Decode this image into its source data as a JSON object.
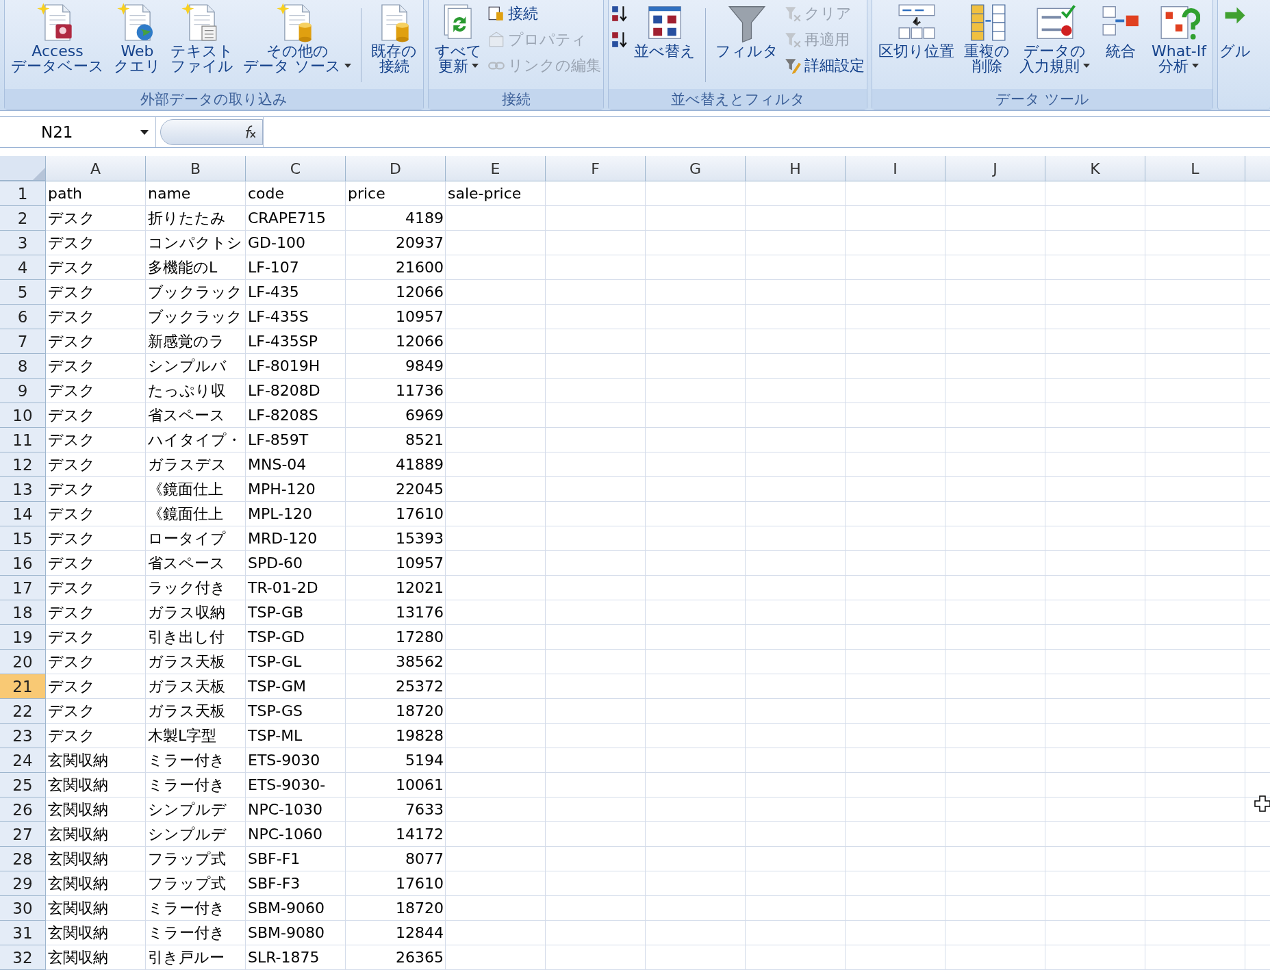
{
  "ribbon": {
    "groups": [
      {
        "label": "外部データの取り込み",
        "items": [
          {
            "kind": "large",
            "lines": [
              "Access",
              "データベース"
            ],
            "dropdown": false
          },
          {
            "kind": "large",
            "lines": [
              "Web",
              "クエリ"
            ],
            "dropdown": false
          },
          {
            "kind": "large",
            "lines": [
              "テキスト",
              "ファイル"
            ],
            "dropdown": false
          },
          {
            "kind": "large",
            "lines": [
              "その他の",
              "データ ソース"
            ],
            "dropdown": true
          },
          {
            "kind": "separator"
          },
          {
            "kind": "large",
            "lines": [
              "既存の",
              "接続"
            ],
            "dropdown": false
          }
        ]
      },
      {
        "label": "接続",
        "items": [
          {
            "kind": "large",
            "lines": [
              "すべて",
              "更新"
            ],
            "dropdown": true
          },
          {
            "kind": "stack",
            "items": [
              {
                "label": "接続",
                "disabled": false
              },
              {
                "label": "プロパティ",
                "disabled": true
              },
              {
                "label": "リンクの編集",
                "disabled": true
              }
            ]
          }
        ]
      },
      {
        "label": "並べ替えとフィルタ",
        "items": [
          {
            "kind": "stack",
            "items": [
              {
                "disabled": false
              },
              {
                "disabled": false
              }
            ]
          },
          {
            "kind": "large",
            "lines": [
              "並べ替え"
            ],
            "dropdown": false
          },
          {
            "kind": "separator"
          },
          {
            "kind": "large",
            "lines": [
              "フィルタ"
            ],
            "dropdown": false
          },
          {
            "kind": "stack",
            "items": [
              {
                "label": "クリア",
                "disabled": true
              },
              {
                "label": "再適用",
                "disabled": true
              },
              {
                "label": "詳細設定",
                "disabled": false
              }
            ]
          }
        ]
      },
      {
        "label": "データ ツール",
        "items": [
          {
            "kind": "large",
            "lines": [
              "区切り位置"
            ],
            "dropdown": false
          },
          {
            "kind": "large",
            "lines": [
              "重複の",
              "削除"
            ],
            "dropdown": false
          },
          {
            "kind": "large",
            "lines": [
              "データの",
              "入力規則"
            ],
            "dropdown": true
          },
          {
            "kind": "large",
            "lines": [
              "統合"
            ],
            "dropdown": false
          },
          {
            "kind": "large",
            "lines": [
              "What-If",
              "分析"
            ],
            "dropdown": true
          }
        ]
      },
      {
        "items": [
          {
            "kind": "large",
            "lines": [
              "グル"
            ],
            "dropdown": false
          }
        ]
      }
    ]
  },
  "name_box": "N21",
  "columns": [
    "A",
    "B",
    "C",
    "D",
    "E",
    "F",
    "G",
    "H",
    "I",
    "J",
    "K",
    "L"
  ],
  "rows": [
    {
      "number": "1",
      "selected": false,
      "cells": [
        "path",
        "name",
        "code",
        "price",
        "sale-price"
      ]
    },
    {
      "number": "2",
      "selected": false,
      "cells": [
        "デスク",
        "折りたたみ",
        "CRAPE715",
        "4189"
      ]
    },
    {
      "number": "3",
      "selected": false,
      "cells": [
        "デスク",
        "コンパクトシ",
        "GD-100",
        "20937"
      ]
    },
    {
      "number": "4",
      "selected": false,
      "cells": [
        "デスク",
        "多機能のL",
        "LF-107",
        "21600"
      ]
    },
    {
      "number": "5",
      "selected": false,
      "cells": [
        "デスク",
        "ブックラック",
        "LF-435",
        "12066"
      ]
    },
    {
      "number": "6",
      "selected": false,
      "cells": [
        "デスク",
        "ブックラック",
        "LF-435S",
        "10957"
      ]
    },
    {
      "number": "7",
      "selected": false,
      "cells": [
        "デスク",
        "新感覚のラ",
        "LF-435SP",
        "12066"
      ]
    },
    {
      "number": "8",
      "selected": false,
      "cells": [
        "デスク",
        "シンプルバ",
        "LF-8019H",
        "9849"
      ]
    },
    {
      "number": "9",
      "selected": false,
      "cells": [
        "デスク",
        "たっぷり収",
        "LF-8208D",
        "11736"
      ]
    },
    {
      "number": "10",
      "selected": false,
      "cells": [
        "デスク",
        "省スペース",
        "LF-8208S",
        "6969"
      ]
    },
    {
      "number": "11",
      "selected": false,
      "cells": [
        "デスク",
        "ハイタイプ・",
        "LF-859T",
        "8521"
      ]
    },
    {
      "number": "12",
      "selected": false,
      "cells": [
        "デスク",
        "ガラスデス",
        "MNS-04",
        "41889"
      ]
    },
    {
      "number": "13",
      "selected": false,
      "cells": [
        "デスク",
        "《鏡面仕上",
        "MPH-120",
        "22045"
      ]
    },
    {
      "number": "14",
      "selected": false,
      "cells": [
        "デスク",
        "《鏡面仕上",
        "MPL-120",
        "17610"
      ]
    },
    {
      "number": "15",
      "selected": false,
      "cells": [
        "デスク",
        "ロータイプ",
        "MRD-120",
        "15393"
      ]
    },
    {
      "number": "16",
      "selected": false,
      "cells": [
        "デスク",
        "省スペース",
        "SPD-60",
        "10957"
      ]
    },
    {
      "number": "17",
      "selected": false,
      "cells": [
        "デスク",
        "ラック付き",
        "TR-01-2D",
        "12021"
      ]
    },
    {
      "number": "18",
      "selected": false,
      "cells": [
        "デスク",
        "ガラス収納",
        "TSP-GB",
        "13176"
      ]
    },
    {
      "number": "19",
      "selected": false,
      "cells": [
        "デスク",
        "引き出し付",
        "TSP-GD",
        "17280"
      ]
    },
    {
      "number": "20",
      "selected": false,
      "cells": [
        "デスク",
        "ガラス天板",
        "TSP-GL",
        "38562"
      ]
    },
    {
      "number": "21",
      "selected": true,
      "cells": [
        "デスク",
        "ガラス天板",
        "TSP-GM",
        "25372"
      ]
    },
    {
      "number": "22",
      "selected": false,
      "cells": [
        "デスク",
        "ガラス天板",
        "TSP-GS",
        "18720"
      ]
    },
    {
      "number": "23",
      "selected": false,
      "cells": [
        "デスク",
        "木製L字型",
        "TSP-ML",
        "19828"
      ]
    },
    {
      "number": "24",
      "selected": false,
      "cells": [
        "玄関収納",
        "ミラー付き",
        "ETS-9030",
        "5194"
      ]
    },
    {
      "number": "25",
      "selected": false,
      "cells": [
        "玄関収納",
        "ミラー付き",
        "ETS-9030-",
        "10061"
      ]
    },
    {
      "number": "26",
      "selected": false,
      "cells": [
        "玄関収納",
        "シンプルデ",
        "NPC-1030",
        "7633"
      ]
    },
    {
      "number": "27",
      "selected": false,
      "cells": [
        "玄関収納",
        "シンプルデ",
        "NPC-1060",
        "14172"
      ]
    },
    {
      "number": "28",
      "selected": false,
      "cells": [
        "玄関収納",
        "フラップ式",
        "SBF-F1",
        "8077"
      ]
    },
    {
      "number": "29",
      "selected": false,
      "cells": [
        "玄関収納",
        "フラップ式",
        "SBF-F3",
        "17610"
      ]
    },
    {
      "number": "30",
      "selected": false,
      "cells": [
        "玄関収納",
        "ミラー付き",
        "SBM-9060",
        "18720"
      ]
    },
    {
      "number": "31",
      "selected": false,
      "cells": [
        "玄関収納",
        "ミラー付き",
        "SBM-9080",
        "12844"
      ]
    },
    {
      "number": "32",
      "selected": false,
      "cells": [
        "玄関収納",
        "引き戸ルー",
        "SLR-1875",
        "26365"
      ]
    }
  ]
}
